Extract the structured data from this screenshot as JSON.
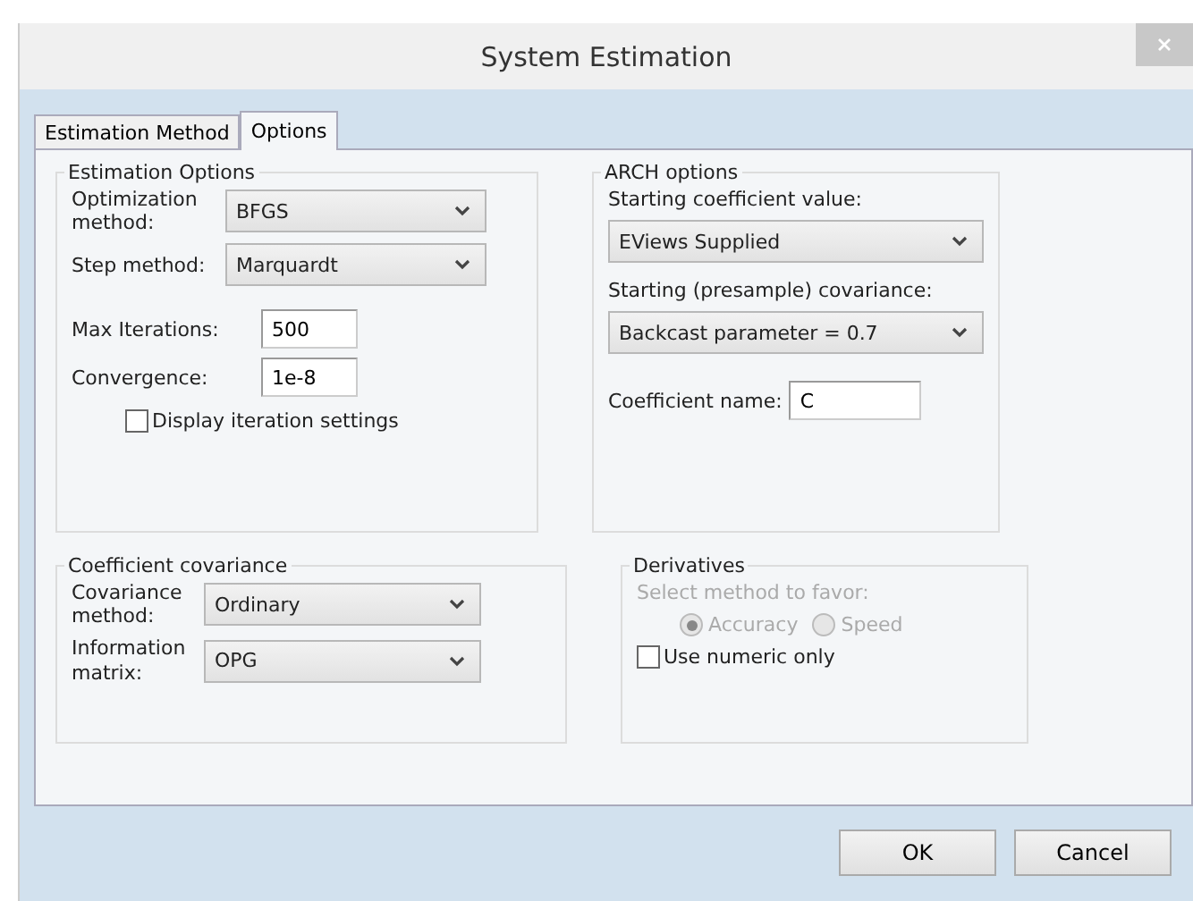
{
  "window": {
    "title": "System Estimation"
  },
  "tabs": [
    {
      "label": "Estimation Method",
      "selected": false
    },
    {
      "label": "Options",
      "selected": true
    }
  ],
  "estimation_options": {
    "title": "Estimation Options",
    "optimization_method": {
      "label": "Optimization method:",
      "value": "BFGS"
    },
    "step_method": {
      "label": "Step method:",
      "value": "Marquardt"
    },
    "max_iterations": {
      "label": "Max Iterations:",
      "value": "500"
    },
    "convergence": {
      "label": "Convergence:",
      "value": "1e-8"
    },
    "display_iteration_settings": {
      "label": "Display iteration settings",
      "checked": false
    }
  },
  "arch_options": {
    "title": "ARCH options",
    "starting_coefficient_value": {
      "label": "Starting coefficient value:",
      "value": "EViews Supplied"
    },
    "starting_covariance": {
      "label": "Starting (presample) covariance:",
      "value": "Backcast parameter = 0.7"
    },
    "coefficient_name": {
      "label": "Coefficient name:",
      "value": "C"
    }
  },
  "coefficient_covariance": {
    "title": "Coefficient covariance",
    "covariance_method": {
      "label": "Covariance method:",
      "value": "Ordinary"
    },
    "information_matrix": {
      "label": "Information matrix:",
      "value": "OPG"
    }
  },
  "derivatives": {
    "title": "Derivatives",
    "hint": "Select method to favor:",
    "disabled": true,
    "radios": [
      {
        "label": "Accuracy",
        "selected": true
      },
      {
        "label": "Speed",
        "selected": false
      }
    ],
    "use_numeric_only": {
      "label": "Use numeric only",
      "checked": false
    }
  },
  "buttons": [
    "OK",
    "Cancel"
  ]
}
